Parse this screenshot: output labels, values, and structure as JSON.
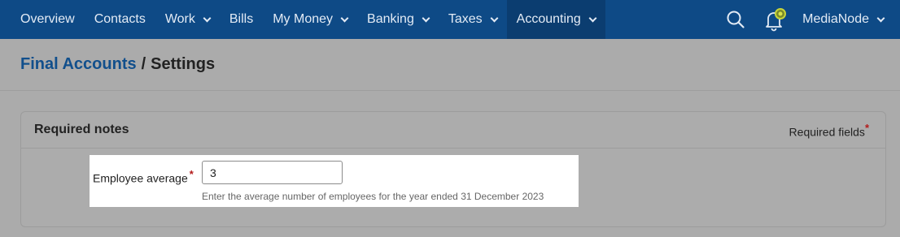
{
  "nav": {
    "items": [
      {
        "label": "Overview"
      },
      {
        "label": "Contacts"
      },
      {
        "label": "Work"
      },
      {
        "label": "Bills"
      },
      {
        "label": "My Money"
      },
      {
        "label": "Banking"
      },
      {
        "label": "Taxes"
      },
      {
        "label": "Accounting"
      }
    ],
    "active": "Accounting",
    "search_icon": "search-icon",
    "notification_icon": "bell-icon",
    "user_label": "MediaNode",
    "colors": {
      "bar": "#0e4a86",
      "active": "#0b3d70",
      "text": "#e3ebf5"
    }
  },
  "breadcrumb": {
    "link_label": "Final Accounts",
    "separator": "/",
    "current_label": "Settings"
  },
  "panel": {
    "title": "Required notes",
    "required_legend": "Required fields",
    "required_marker": "*"
  },
  "form": {
    "employee_average": {
      "label": "Employee average",
      "required_marker": "*",
      "value": "3",
      "help": "Enter the average number of employees for the year ended 31 December 2023"
    }
  },
  "colors": {
    "link": "#114f8c",
    "required": "#b31a1a",
    "overlay": "#ababab"
  }
}
